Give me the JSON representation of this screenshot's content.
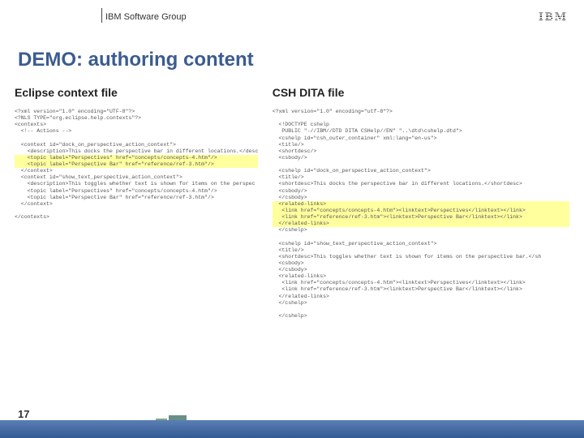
{
  "header": {
    "brand": "IBM Software Group",
    "logo": "IBM"
  },
  "title": "DEMO: authoring content",
  "columns": {
    "left": {
      "heading": "Eclipse context file",
      "code_lines": [
        {
          "t": "<?xml version=\"1.0\" encoding=\"UTF-8\"?>"
        },
        {
          "t": "<?NLS TYPE=\"org.eclipse.help.contexts\"?>"
        },
        {
          "t": "<contexts>"
        },
        {
          "t": "  <!-- Actions -->"
        },
        {
          "t": ""
        },
        {
          "t": "  <context id=\"dock_on_perspective_action_context\">"
        },
        {
          "t": "    <description>This docks the perspective bar in different locations.</desc"
        },
        {
          "t": "    <topic label=\"Perspectives\" href=\"concepts/concepts-4.htm\"/>",
          "hl": true
        },
        {
          "t": "    <topic label=\"Perspective Bar\" href=\"reference/ref-3.htm\"/>",
          "hl": true
        },
        {
          "t": "  </context>"
        },
        {
          "t": "  <context id=\"show_text_perspective_action_context\">"
        },
        {
          "t": "    <description>This toggles whether text is shown for items on the perspec"
        },
        {
          "t": "    <topic label=\"Perspectives\" href=\"concepts/concepts-4.htm\"/>"
        },
        {
          "t": "    <topic label=\"Perspective Bar\" href=\"reference/ref-3.htm\"/>"
        },
        {
          "t": "  </context>"
        },
        {
          "t": ""
        },
        {
          "t": "</contexts>"
        }
      ]
    },
    "right": {
      "heading": "CSH DITA file",
      "code_lines": [
        {
          "t": "<?xml version=\"1.0\" encoding=\"utf-8\"?>"
        },
        {
          "t": ""
        },
        {
          "t": "  <!DOCTYPE cshelp"
        },
        {
          "t": "   PUBLIC \"-//IBM//DTD DITA CSHelp//EN\" \"..\\dtd\\cshelp.dtd\">"
        },
        {
          "t": "  <cshelp id=\"csh_outer_container\" xml:lang=\"en-us\">"
        },
        {
          "t": "  <title/>"
        },
        {
          "t": "  <shortdesc/>"
        },
        {
          "t": "  <csbody/>"
        },
        {
          "t": ""
        },
        {
          "t": "  <cshelp id=\"dock_on_perspective_action_context\">"
        },
        {
          "t": "  <title/>"
        },
        {
          "t": "  <shortdesc>This docks the perspective bar in different locations.</shortdesc>"
        },
        {
          "t": "  <csbody/>"
        },
        {
          "t": "  </csbody>"
        },
        {
          "t": "  <related-links>",
          "hl": true
        },
        {
          "t": "   <link href=\"concepts/concepts-4.htm\"><linktext>Perspectives</linktext></link>",
          "hl": true
        },
        {
          "t": "   <link href=\"reference/ref-3.htm\"><linktext>Perspective Bar</linktext></link>",
          "hl": true
        },
        {
          "t": "  </related-links>",
          "hl": true
        },
        {
          "t": "  </cshelp>"
        },
        {
          "t": ""
        },
        {
          "t": "  <cshelp id=\"show_text_perspective_action_context\">"
        },
        {
          "t": "  <title/>"
        },
        {
          "t": "  <shortdesc>This toggles whether text is shown for items on the perspective bar.</sh"
        },
        {
          "t": "  <csbody>"
        },
        {
          "t": "  </csbody>"
        },
        {
          "t": "  <related-links>"
        },
        {
          "t": "   <link href=\"concepts/concepts-4.htm\"><linktext>Perspectives</linktext></link>"
        },
        {
          "t": "   <link href=\"reference/ref-3.htm\"><linktext>Perspective Bar</linktext></link>"
        },
        {
          "t": "  </related-links>"
        },
        {
          "t": "  </cshelp>"
        },
        {
          "t": ""
        },
        {
          "t": "  </cshelp>"
        }
      ]
    }
  },
  "page_number": "17"
}
